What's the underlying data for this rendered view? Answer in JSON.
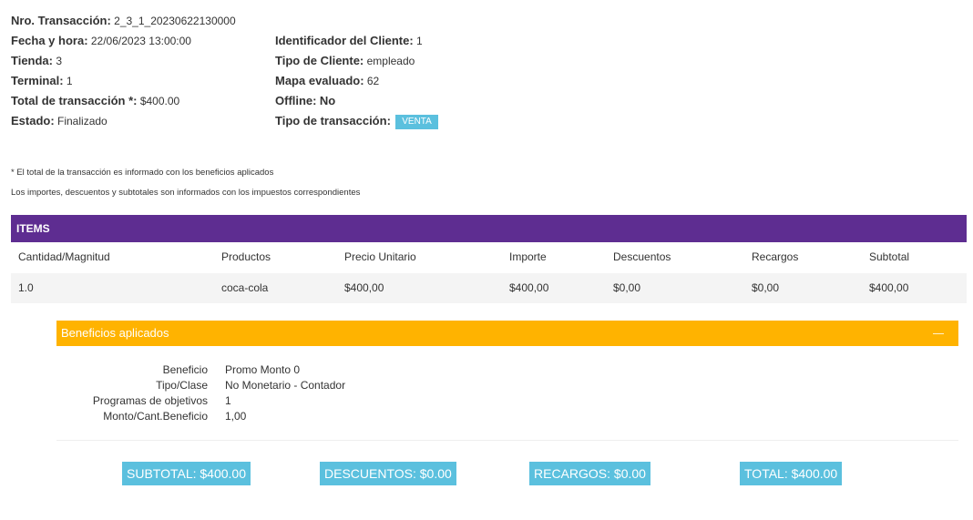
{
  "transaction": {
    "nro_label": "Nro. Transacción:",
    "nro_value": "2_3_1_20230622130000",
    "fecha_label": "Fecha y hora:",
    "fecha_value": "22/06/2023 13:00:00",
    "tienda_label": "Tienda:",
    "tienda_value": "3",
    "terminal_label": "Terminal:",
    "terminal_value": "1",
    "total_label": "Total de transacción *:",
    "total_value": "$400.00",
    "estado_label": "Estado:",
    "estado_value": "Finalizado",
    "cliente_id_label": "Identificador del Cliente:",
    "cliente_id_value": "1",
    "tipo_cliente_label": "Tipo de Cliente:",
    "tipo_cliente_value": "empleado",
    "mapa_label": "Mapa evaluado:",
    "mapa_value": "62",
    "offline_label": "Offline:",
    "offline_value": "No",
    "tipo_tx_label": "Tipo de transacción:",
    "tipo_tx_badge": "VENTA"
  },
  "notes": {
    "note1": "* El total de la transacción es informado con los beneficios aplicados",
    "note2": "Los importes, descuentos y subtotales son informados con los impuestos correspondientes"
  },
  "items": {
    "title": "ITEMS",
    "columns": [
      "Cantidad/Magnitud",
      "Productos",
      "Precio Unitario",
      "Importe",
      "Descuentos",
      "Recargos",
      "Subtotal"
    ],
    "rows": [
      [
        "1.0",
        "coca-cola",
        "$400,00",
        "$400,00",
        "$0,00",
        "$0,00",
        "$400,00"
      ]
    ]
  },
  "beneficios": {
    "title": "Beneficios aplicados",
    "rows": [
      {
        "key": "Beneficio",
        "value": "Promo Monto 0"
      },
      {
        "key": "Tipo/Clase",
        "value": "No Monetario - Contador"
      },
      {
        "key": "Programas de objetivos",
        "value": "1"
      },
      {
        "key": "Monto/Cant.Beneficio",
        "value": "1,00"
      }
    ]
  },
  "totals": {
    "subtotal": "SUBTOTAL: $400.00",
    "descuentos": "DESCUENTOS: $0.00",
    "recargos": "RECARGOS: $0.00",
    "total": "TOTAL: $400.00"
  },
  "colors": {
    "items_header": "#5e2d91",
    "benef_header": "#ffb300",
    "badge": "#5bc0de",
    "totals": "#5bc0de"
  },
  "icons": {
    "collapse": "minus-collapse-icon"
  }
}
